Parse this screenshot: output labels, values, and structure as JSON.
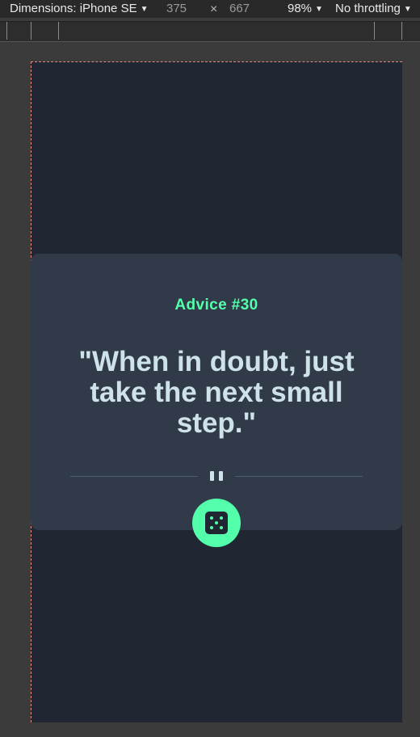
{
  "devtools": {
    "device_label": "Dimensions: iPhone SE",
    "width": "375",
    "height": "667",
    "times_symbol": "×",
    "zoom": "98%",
    "throttling": "No throttling"
  },
  "advice": {
    "id_label": "Advice #30",
    "quote": "\"When in doubt, just take the next small step.\""
  },
  "icons": {
    "divider": "pause-icon",
    "button": "dice-icon"
  },
  "colors": {
    "accent": "#53ffab",
    "card": "#313a48",
    "background": "#202632",
    "text": "#cee3e9"
  }
}
